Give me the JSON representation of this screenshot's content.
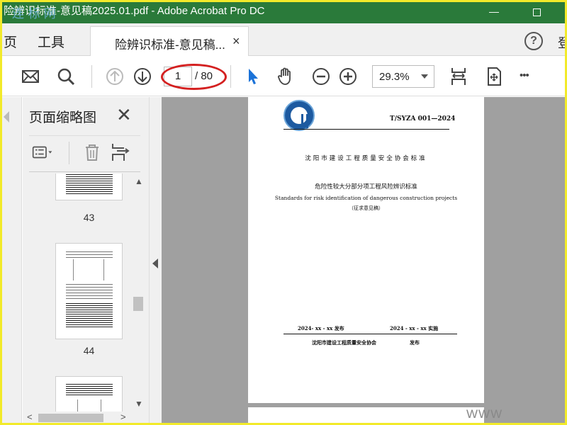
{
  "window": {
    "title": "险辨识标准-意见稿2025.01.pdf - Adobe Acrobat Pro DC",
    "watermark": "连 标 网",
    "minimize": "—"
  },
  "menu": {
    "home": "页",
    "tools": "工具",
    "login": "登"
  },
  "tab": {
    "label": "险辨识标准-意见稿...",
    "close": "×"
  },
  "help": "?",
  "toolbar": {
    "current_page": "1",
    "total_pages": "/ 80",
    "zoom": "29.3%",
    "more": "•••"
  },
  "panel": {
    "title": "页面缩略图",
    "close": "✕",
    "thumbnails": [
      {
        "page": "43"
      },
      {
        "page": "44"
      }
    ]
  },
  "document": {
    "std_code": "T/SYZA 001—2024",
    "association": "沈阳市建设工程质量安全协会标准",
    "title_cn": "危险性较大分部分项工程风险辨识标准",
    "title_en": "Standards for risk identification of dangerous construction projects",
    "draft": "（征求意见稿）",
    "issue_date": "2024- xx - xx  发布",
    "impl_date": "2024 - xx - xx  实施",
    "publisher": "沈阳市建设工程质量安全协会",
    "publish": "发布",
    "watermark": "WWW"
  },
  "colors": {
    "titlebar": "#2a7a3a",
    "border": "#f2ea2a",
    "highlight_ring": "#d42020",
    "select_tool": "#1b72d8"
  }
}
